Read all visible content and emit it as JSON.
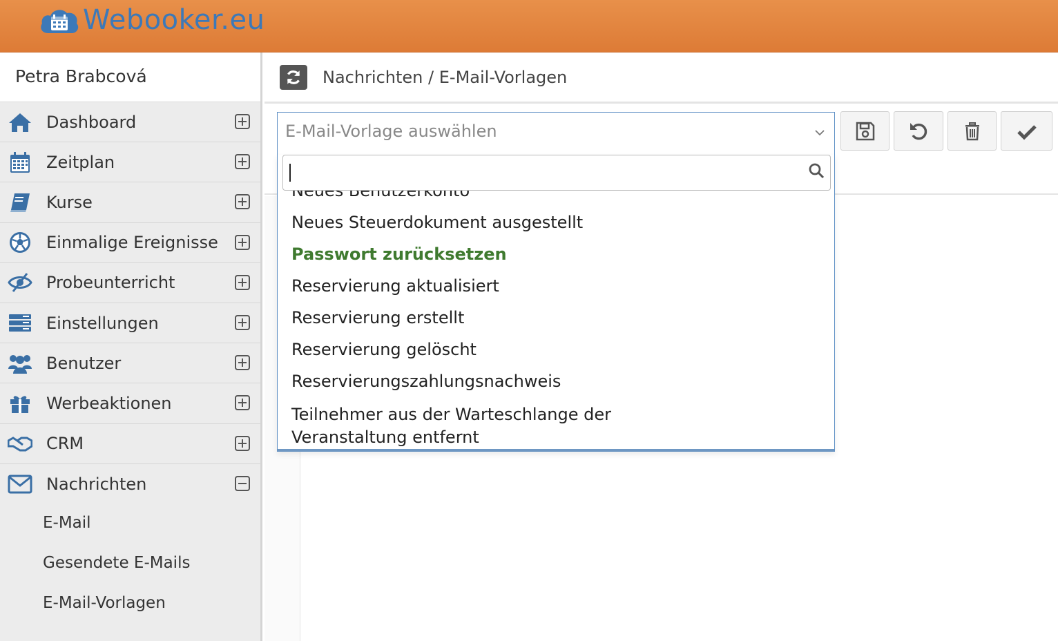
{
  "app": {
    "logo_text": "Webooker.eu"
  },
  "sidebar": {
    "user_name": "Petra Brabcová",
    "items": [
      {
        "label": "Dashboard",
        "icon": "home-icon"
      },
      {
        "label": "Zeitplan",
        "icon": "calendar-icon"
      },
      {
        "label": "Kurse",
        "icon": "book-icon"
      },
      {
        "label": "Einmalige Ereignisse",
        "icon": "soccer-ball-icon"
      },
      {
        "label": "Probeunterricht",
        "icon": "eye-slash-icon"
      },
      {
        "label": "Einstellungen",
        "icon": "server-icon"
      },
      {
        "label": "Benutzer",
        "icon": "users-icon"
      },
      {
        "label": "Werbeaktionen",
        "icon": "gift-icon"
      },
      {
        "label": "CRM",
        "icon": "handshake-icon"
      },
      {
        "label": "Nachrichten",
        "icon": "envelope-icon"
      }
    ],
    "sub_items": [
      {
        "label": "E-Mail"
      },
      {
        "label": "Gesendete E-Mails"
      },
      {
        "label": "E-Mail-Vorlagen"
      }
    ]
  },
  "header": {
    "breadcrumb": "Nachrichten / E-Mail-Vorlagen"
  },
  "template_select": {
    "placeholder": "E-Mail-Vorlage auswählen",
    "search_value": "",
    "options": [
      {
        "label": "Neues Benutzerkonto"
      },
      {
        "label": "Neues Steuerdokument ausgestellt"
      },
      {
        "label": "Passwort zurücksetzen"
      },
      {
        "label": "Reservierung aktualisiert"
      },
      {
        "label": "Reservierung erstellt"
      },
      {
        "label": "Reservierung gelöscht"
      },
      {
        "label": "Reservierungszahlungsnachweis"
      },
      {
        "label": "Teilnehmer aus der Warteschlange der Veranstaltung entfernt"
      }
    ],
    "highlighted_option": "Passwort zurücksetzen"
  },
  "toolbar": {
    "buttons": [
      {
        "icon": "save-icon"
      },
      {
        "icon": "undo-icon"
      },
      {
        "icon": "trash-icon"
      },
      {
        "icon": "check-icon"
      }
    ]
  },
  "colors": {
    "topbar": "#e08640",
    "logo": "#3d79b8",
    "icon_blue": "#3a6fa5",
    "selected_option": "#3f7a2f",
    "select_border": "#5d8fc4"
  }
}
